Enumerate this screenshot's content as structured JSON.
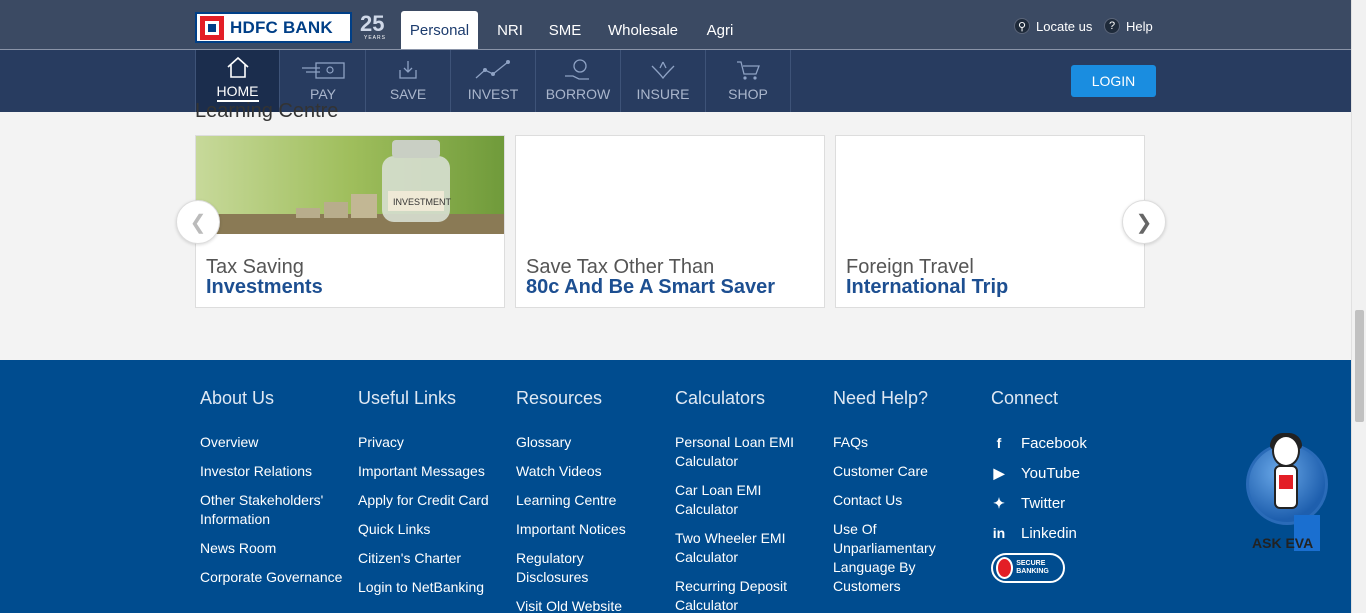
{
  "brand": {
    "name": "HDFC BANK",
    "anniversary": "25",
    "anniversary_sub": "YEARS"
  },
  "top_tabs": [
    {
      "label": "Personal",
      "active": true
    },
    {
      "label": "NRI",
      "active": false
    },
    {
      "label": "SME",
      "active": false
    },
    {
      "label": "Wholesale",
      "active": false
    },
    {
      "label": "Agri",
      "active": false
    }
  ],
  "utility": {
    "locate": "Locate us",
    "help": "Help",
    "locate_icon": "location-pin-icon",
    "help_icon": "question-icon"
  },
  "nav": [
    {
      "label": "HOME",
      "icon": "home-icon",
      "active": true
    },
    {
      "label": "PAY",
      "icon": "pay-icon",
      "active": false
    },
    {
      "label": "SAVE",
      "icon": "save-icon",
      "active": false
    },
    {
      "label": "INVEST",
      "icon": "invest-icon",
      "active": false
    },
    {
      "label": "BORROW",
      "icon": "borrow-icon",
      "active": false
    },
    {
      "label": "INSURE",
      "icon": "insure-icon",
      "active": false
    },
    {
      "label": "SHOP",
      "icon": "shop-icon",
      "active": false
    }
  ],
  "login_label": "LOGIN",
  "learning": {
    "title": "Learning Centre",
    "cards": [
      {
        "line1": "Tax Saving",
        "line2": "Investments",
        "image": "investment-jar-image"
      },
      {
        "line1": "Save Tax Other Than",
        "line2": "80c And Be A Smart Saver",
        "image": ""
      },
      {
        "line1": "Foreign Travel",
        "line2": "International Trip",
        "image": ""
      }
    ],
    "prev_icon": "chevron-left-icon",
    "next_icon": "chevron-right-icon"
  },
  "footer": {
    "about": {
      "head": "About Us",
      "links": [
        "Overview",
        "Investor Relations",
        "Other Stakeholders' Information",
        "News Room",
        "Corporate Governance"
      ]
    },
    "useful": {
      "head": "Useful Links",
      "links": [
        "Privacy",
        "Important Messages",
        "Apply for Credit Card",
        "Quick Links",
        "Citizen's Charter",
        "Login to NetBanking"
      ]
    },
    "resources": {
      "head": "Resources",
      "links": [
        "Glossary",
        "Watch Videos",
        "Learning Centre",
        "Important Notices",
        "Regulatory Disclosures",
        "Visit Old Website"
      ]
    },
    "calculators": {
      "head": "Calculators",
      "links": [
        "Personal Loan EMI Calculator",
        "Car Loan EMI Calculator",
        "Two Wheeler EMI Calculator",
        "Recurring Deposit Calculator"
      ]
    },
    "help": {
      "head": "Need Help?",
      "links": [
        "FAQs",
        "Customer Care",
        "Contact Us",
        "Use Of Unparliamentary Language By Customers"
      ]
    },
    "connect": {
      "head": "Connect",
      "links": [
        {
          "label": "Facebook",
          "icon": "facebook-icon"
        },
        {
          "label": "YouTube",
          "icon": "youtube-icon"
        },
        {
          "label": "Twitter",
          "icon": "twitter-icon"
        },
        {
          "label": "Linkedin",
          "icon": "linkedin-icon"
        }
      ],
      "badge": "SECURE BANKING"
    }
  },
  "ask_eva": "ASK EVA"
}
